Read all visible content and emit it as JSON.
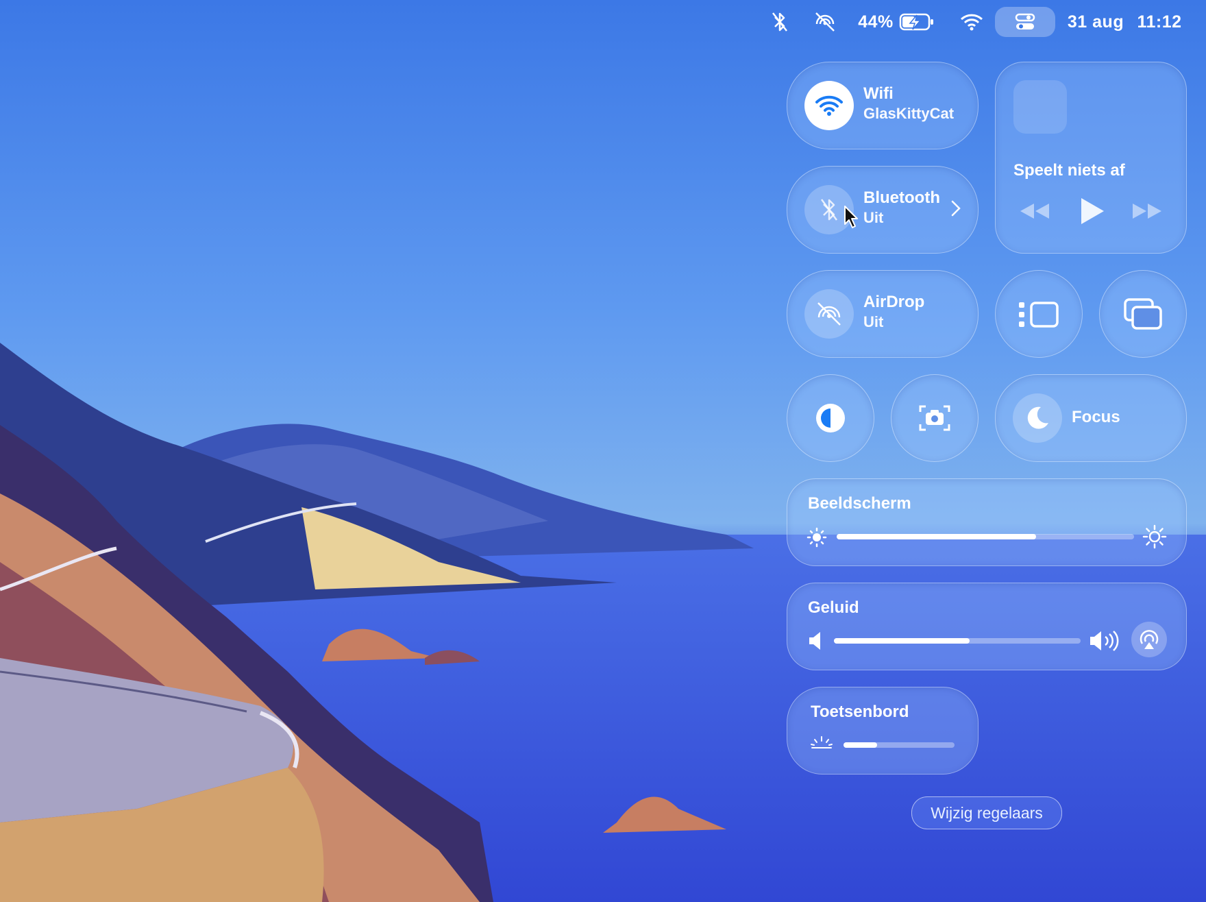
{
  "menubar": {
    "battery_percent": "44%",
    "date": "31 aug",
    "time": "11:12",
    "icons": [
      "bluetooth-off-icon",
      "airdrop-off-icon",
      "battery-charging-icon",
      "wifi-icon",
      "control-center-icon"
    ]
  },
  "control_center": {
    "wifi": {
      "title": "Wifi",
      "network": "GlasKittyCat",
      "icon": "wifi-icon"
    },
    "bluetooth": {
      "title": "Bluetooth",
      "status": "Uit",
      "icon": "bluetooth-off-icon"
    },
    "airdrop": {
      "title": "AirDrop",
      "status": "Uit",
      "icon": "airdrop-off-icon"
    },
    "now_playing": {
      "label": "Speelt niets af"
    },
    "focus": {
      "label": "Focus",
      "icon": "moon-icon"
    },
    "display": {
      "title": "Beeldscherm",
      "level": 0.67
    },
    "sound": {
      "title": "Geluid",
      "level": 0.55
    },
    "keyboard": {
      "title": "Toetsenbord",
      "level": 0.3
    },
    "edit_button": "Wijzig regelaars"
  },
  "colors": {
    "accent": "#1a7cf5",
    "sky_top": "#3d7be6",
    "sea": "#3f63e0"
  }
}
